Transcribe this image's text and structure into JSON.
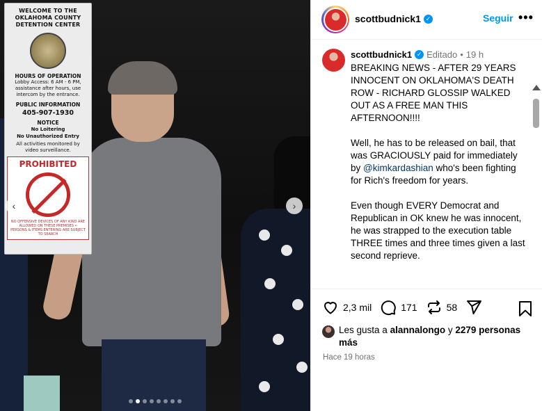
{
  "photo": {
    "sign": {
      "welcome": "WELCOME TO THE OKLAHOMA COUNTY DETENTION CENTER",
      "hours_title": "HOURS OF OPERATION",
      "hours_text": "Lobby Access: 6 AM - 6 PM, assistance after hours, use intercom by the entrance.",
      "public_info": "PUBLIC INFORMATION",
      "phone": "405-907-1930",
      "notice": "NOTICE",
      "no_loitering": "No Loitering",
      "no_entry": "No Unauthorized Entry",
      "monitored": "All activities monitored by video surveillance.",
      "prohibited": "PROHIBITED",
      "fine_print": "NO OFFENSIVE DEVICES OF ANY KIND ARE ALLOWED ON THESE PREMISES • PERSONS & ITEMS ENTERING ARE SUBJECT TO SEARCH"
    },
    "nav_prev_icon": "‹",
    "nav_next_icon": "›",
    "carousel": {
      "total": 8,
      "active_index": 1
    }
  },
  "header": {
    "username": "scottbudnick1",
    "verified_icon": "✓",
    "follow_label": "Seguir",
    "more_icon": "•••"
  },
  "caption": {
    "username": "scottbudnick1",
    "edited": "Editado",
    "separator": "•",
    "time": "19 h",
    "p1": "BREAKING NEWS - AFTER 29 YEARS INNOCENT ON OKLAHOMA'S DEATH ROW - RICHARD GLOSSIP WALKED OUT AS A FREE MAN THIS AFTERNOON!!!!",
    "p2_before": "Well, he has to be released on bail, that was GRACIOUSLY paid for immediately by ",
    "p2_mention": "@kimkardashian",
    "p2_after": " who's been fighting for Rich's freedom for years.",
    "p3": "Even though EVERY Democrat and Republican in OK knew he was innocent, he was strapped to the execution table THREE times and three times given a last second reprieve."
  },
  "actions": {
    "likes_count": "2,3 mil",
    "comments_count": "171",
    "reposts_count": "58",
    "likes_prefix": "Les gusta a",
    "likes_user": "alannalongo",
    "likes_mid": "y",
    "likes_others": "2279 personas más",
    "time_ago": "Hace 19 horas"
  }
}
